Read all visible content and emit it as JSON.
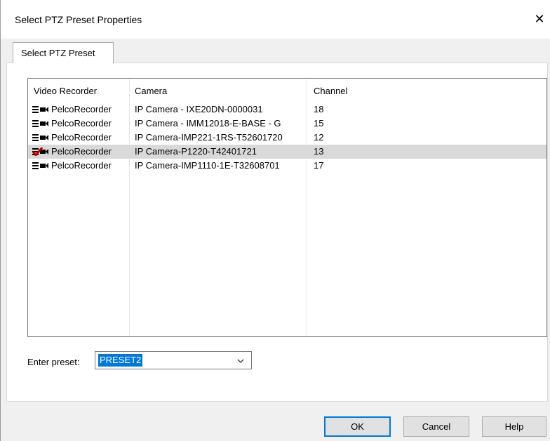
{
  "window": {
    "title": "Select PTZ Preset Properties",
    "close_glyph": "✕"
  },
  "tabs": [
    {
      "label": "Select PTZ Preset",
      "active": true
    }
  ],
  "list": {
    "columns": [
      "Video Recorder",
      "Camera",
      "Channel"
    ],
    "rows": [
      {
        "recorder": "PelcoRecorder",
        "camera": "IP Camera - IXE20DN-0000031",
        "channel": "18",
        "icon": "recorder-icon",
        "selected": false
      },
      {
        "recorder": "PelcoRecorder",
        "camera": "IP Camera - IMM12018-E-BASE - G",
        "channel": "15",
        "icon": "recorder-icon",
        "selected": false
      },
      {
        "recorder": "PelcoRecorder",
        "camera": "IP Camera-IMP221-1RS-T52601720",
        "channel": "12",
        "icon": "recorder-icon",
        "selected": false
      },
      {
        "recorder": "PelcoRecorder",
        "camera": "IP Camera-P1220-T42401721",
        "channel": "13",
        "icon": "recorder-checked-icon",
        "selected": true
      },
      {
        "recorder": "PelcoRecorder",
        "camera": "IP Camera-IMP1110-1E-T32608701",
        "channel": "17",
        "icon": "recorder-icon",
        "selected": false
      }
    ]
  },
  "preset": {
    "label": "Enter preset:",
    "value": "PRESET2"
  },
  "buttons": {
    "ok": "OK",
    "cancel": "Cancel",
    "help": "Help"
  },
  "colors": {
    "selection": "#0078d7",
    "selected_row": "#d9d9d9",
    "check_mark": "#c00000"
  }
}
